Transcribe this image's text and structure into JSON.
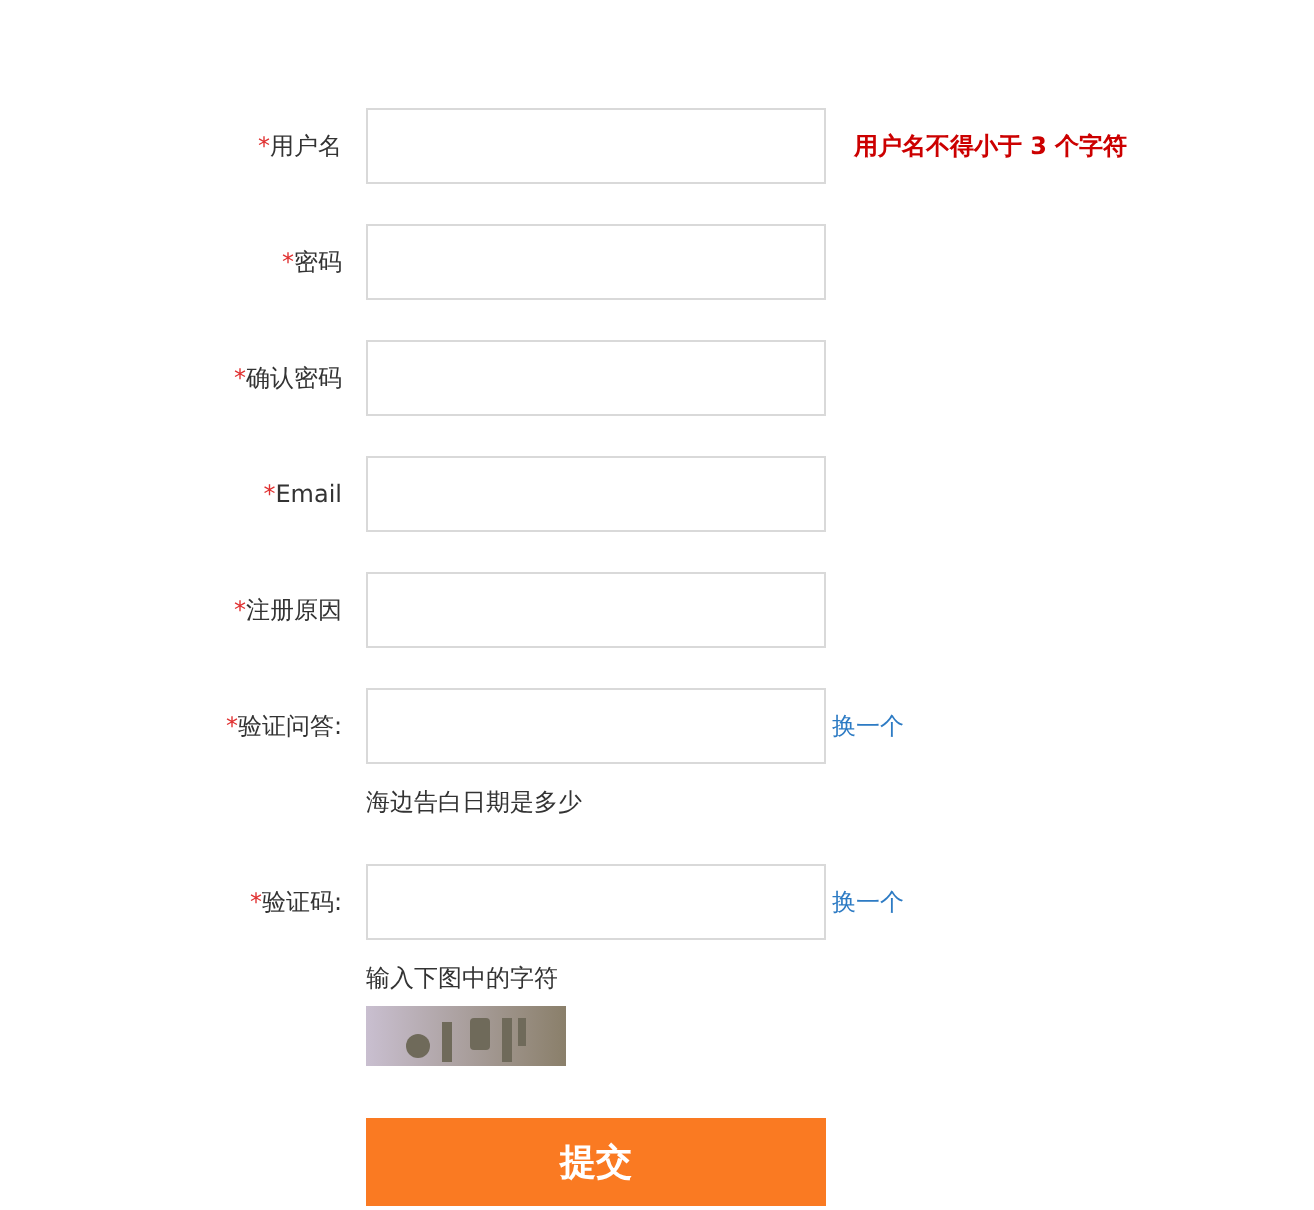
{
  "fields": [
    {
      "mark": "*",
      "label": "用户名",
      "error": "用户名不得小于 3 个字符"
    },
    {
      "mark": "*",
      "label": "密码"
    },
    {
      "mark": "*",
      "label": "确认密码"
    },
    {
      "mark": "*",
      "label": "Email"
    },
    {
      "mark": "*",
      "label": "注册原因"
    },
    {
      "mark": "*",
      "label": "验证问答:",
      "link": "换一个",
      "hint": "海边告白日期是多少"
    },
    {
      "mark": "*",
      "label": "验证码:",
      "link": "换一个",
      "hint": "输入下图中的字符"
    }
  ],
  "submit": "提交"
}
